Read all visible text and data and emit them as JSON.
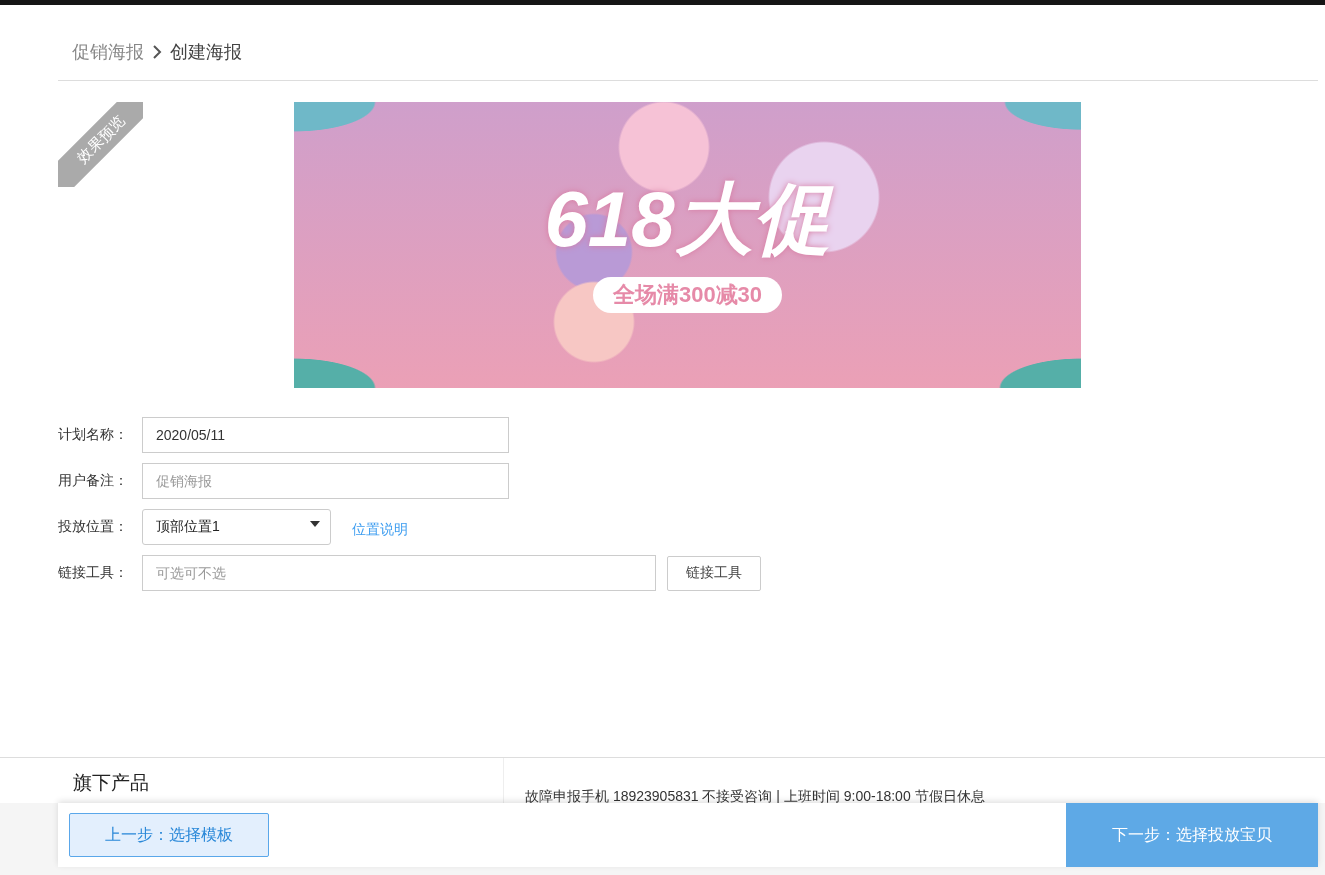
{
  "breadcrumb": [
    {
      "label": "促销海报",
      "current": false
    },
    {
      "label": "创建海报",
      "current": true
    }
  ],
  "preview": {
    "ribbon": "效果预览",
    "poster": {
      "headline": "618大促",
      "offer": "全场满300减30"
    }
  },
  "form": {
    "fields": [
      {
        "kind": "text",
        "label": "计划名称：",
        "value": "2020/05/11"
      },
      {
        "kind": "text",
        "label": "用户备注：",
        "placeholder": "促销海报"
      },
      {
        "kind": "select",
        "label": "投放位置：",
        "value": "顶部位置1",
        "link": "位置说明"
      },
      {
        "kind": "text-button",
        "label": "链接工具：",
        "placeholder": "可选可不选",
        "button": "链接工具"
      }
    ]
  },
  "footer": {
    "heading": "旗下产品",
    "notice": "故障申报手机 18923905831 不接受咨询 | 上班时间 9:00-18:00 节假日休息"
  },
  "actions": {
    "back": "上一步：选择模板",
    "next": "下一步：选择投放宝贝"
  }
}
